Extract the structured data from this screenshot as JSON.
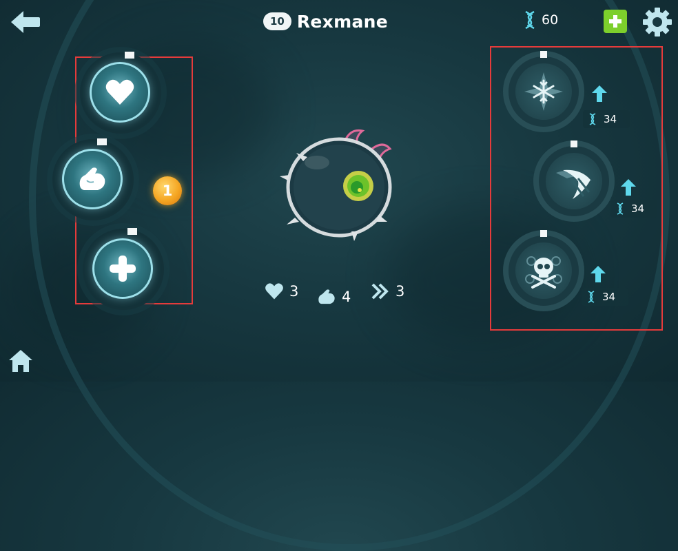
{
  "header": {
    "level": "10",
    "name": "Rexmane",
    "dna_count": "60"
  },
  "icons": {
    "back": "back-arrow-icon",
    "home": "home-icon",
    "dna": "dna-icon",
    "add": "plus-icon",
    "settings": "gear-icon"
  },
  "stats_panel": {
    "buttons": [
      {
        "stat": "health",
        "icon": "heart-icon"
      },
      {
        "stat": "strength",
        "icon": "flexed-arm-icon"
      },
      {
        "stat": "speed",
        "icon": "plus-icon"
      }
    ],
    "points_available": "1"
  },
  "abilities": [
    {
      "name": "frost",
      "icon": "snowflake-icon",
      "cost": "34"
    },
    {
      "name": "claw",
      "icon": "claw-slash-icon",
      "cost": "34"
    },
    {
      "name": "poison",
      "icon": "skull-crossbones-icon",
      "cost": "34"
    }
  ],
  "creature_stats": {
    "health": "3",
    "strength": "4",
    "speed": "3"
  },
  "colors": {
    "background": "#173840",
    "accent_cyan": "#5fd8ec",
    "add_button": "#7dcf2c",
    "points_badge": "#f5a623",
    "highlight_box": "#e53b3b"
  }
}
